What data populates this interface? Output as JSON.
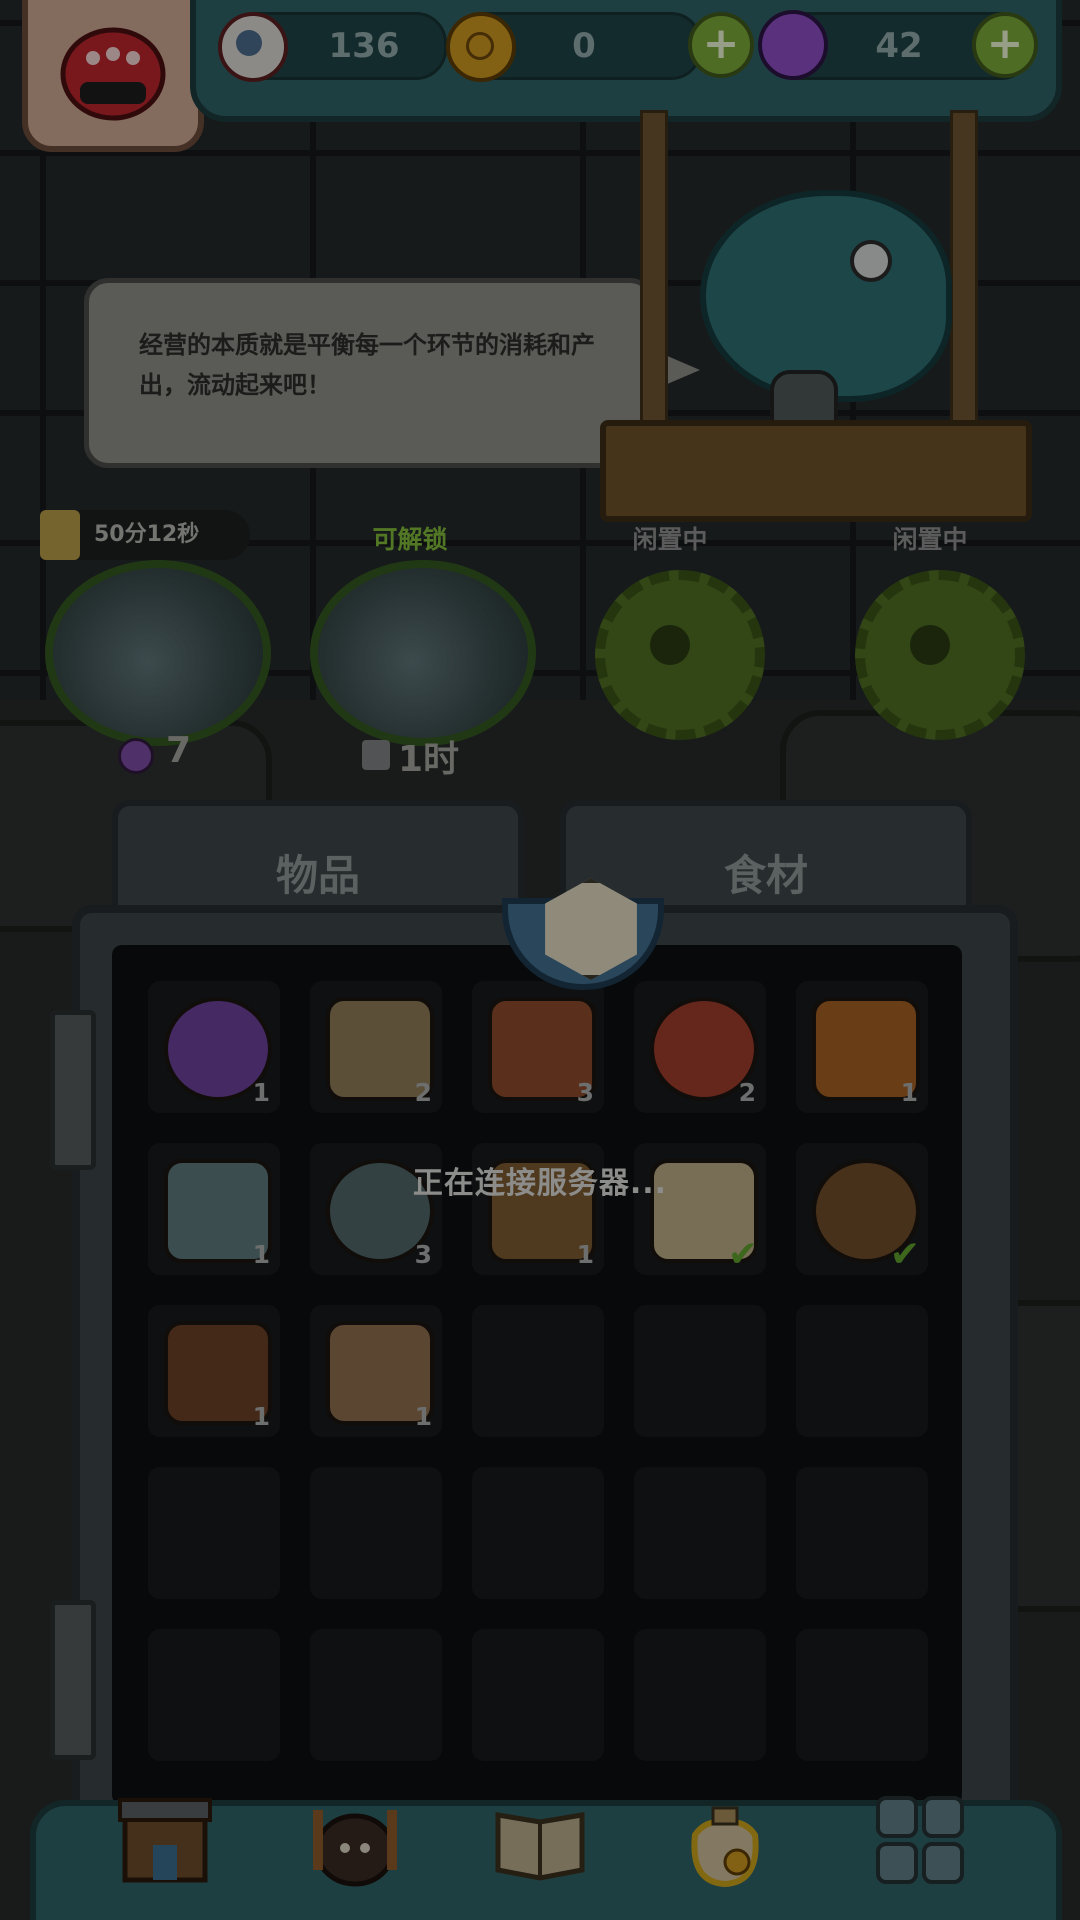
{
  "resources": {
    "eyeball": {
      "value": "136",
      "icon": "eyeball-icon"
    },
    "coin": {
      "value": "0",
      "icon": "coin-icon"
    },
    "potion": {
      "value": "42",
      "icon": "potion-icon"
    },
    "plus_label": "+"
  },
  "dialog": {
    "text": "经营的本质就是平衡每一个环节的消耗和产出，流动起来吧！"
  },
  "slots": [
    {
      "status": "50分12秒",
      "status_type": "timer",
      "footer": "7",
      "footer_icon": "potion-icon"
    },
    {
      "status": "可解锁",
      "status_type": "unlockable",
      "footer": "1时",
      "footer_icon": "lock-icon"
    },
    {
      "status": "闲置中",
      "status_type": "idle"
    },
    {
      "status": "闲置中",
      "status_type": "idle"
    }
  ],
  "tabs": {
    "items": "物品",
    "ingredients": "食材"
  },
  "inventory": [
    {
      "name": "purple-powder",
      "count": "1",
      "color": "#6a3f97"
    },
    {
      "name": "rope",
      "count": "2",
      "color": "#8c7a57"
    },
    {
      "name": "club",
      "count": "3",
      "color": "#8a4a2c"
    },
    {
      "name": "red-urchin",
      "count": "2",
      "color": "#9b3b2c"
    },
    {
      "name": "feather",
      "count": "1",
      "color": "#a25f22"
    },
    {
      "name": "pearl",
      "count": "1",
      "color": "#5b7778"
    },
    {
      "name": "shell-creature",
      "count": "3",
      "color": "#4f6568"
    },
    {
      "name": "turtle-shell",
      "count": "1",
      "color": "#7a5a30"
    },
    {
      "name": "scroll",
      "count": "",
      "checked": true,
      "color": "#b9aa84"
    },
    {
      "name": "rune-board",
      "count": "",
      "checked": true,
      "color": "#6e4c2a"
    },
    {
      "name": "wood-box",
      "count": "1",
      "color": "#6a3f25"
    },
    {
      "name": "map",
      "count": "1",
      "color": "#8c6c4e"
    }
  ],
  "loading": {
    "text": "正在连接服务器..."
  },
  "nav": [
    {
      "name": "shop",
      "icon": "shop-icon"
    },
    {
      "name": "monster-cave",
      "icon": "cave-icon"
    },
    {
      "name": "book",
      "icon": "book-icon"
    },
    {
      "name": "bag",
      "icon": "bag-icon"
    },
    {
      "name": "more",
      "icon": "grid-icon"
    }
  ],
  "colors": {
    "accent_teal": "#2f6165",
    "unlockable_green": "#7fb83a",
    "idle_gray": "#8a8c8a",
    "check_green": "#5f9e2c"
  }
}
